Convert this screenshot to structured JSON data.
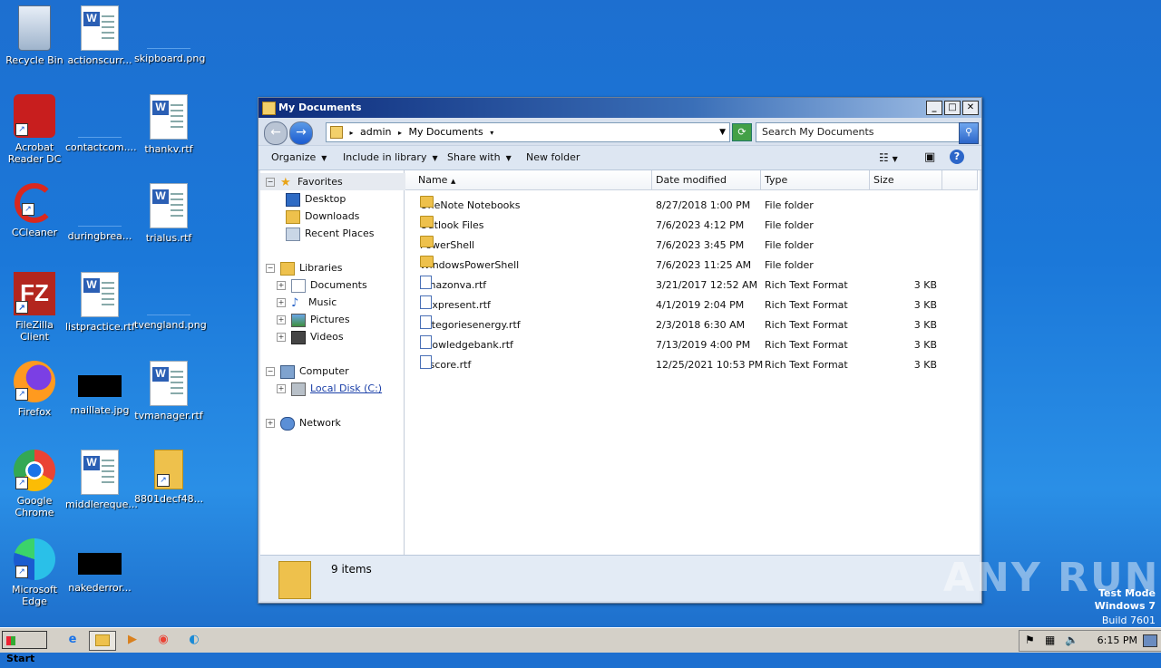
{
  "desktop": {
    "icons": [
      {
        "label": "Recycle Bin"
      },
      {
        "label": "actionscurr..."
      },
      {
        "label": "skipboard.png"
      },
      {
        "label": "Acrobat Reader DC"
      },
      {
        "label": "contactcom...."
      },
      {
        "label": "thankv.rtf"
      },
      {
        "label": "CCleaner"
      },
      {
        "label": "duringbrea..."
      },
      {
        "label": "trialus.rtf"
      },
      {
        "label": "FileZilla Client"
      },
      {
        "label": "listpractice.rtf"
      },
      {
        "label": "tvengland.png"
      },
      {
        "label": "Firefox"
      },
      {
        "label": "maillate.jpg"
      },
      {
        "label": "tvmanager.rtf"
      },
      {
        "label": "Google Chrome"
      },
      {
        "label": "middlereque..."
      },
      {
        "label": "8801decf48..."
      },
      {
        "label": "Microsoft Edge"
      },
      {
        "label": "nakederror..."
      }
    ]
  },
  "window": {
    "title": "My Documents",
    "address": {
      "crumb1": "admin",
      "crumb2": "My Documents"
    },
    "search_placeholder": "Search My Documents",
    "toolbar": {
      "organize": "Organize",
      "include": "Include in library",
      "share": "Share with",
      "new_folder": "New folder"
    },
    "nav": {
      "favorites": "Favorites",
      "desktop": "Desktop",
      "downloads": "Downloads",
      "recent": "Recent Places",
      "libraries": "Libraries",
      "documents": "Documents",
      "music": "Music",
      "pictures": "Pictures",
      "videos": "Videos",
      "computer": "Computer",
      "localdisk": "Local Disk (C:)",
      "network": "Network"
    },
    "columns": {
      "name": "Name",
      "date": "Date modified",
      "type": "Type",
      "size": "Size"
    },
    "files": [
      {
        "name": "OneNote Notebooks",
        "date": "8/27/2018 1:00 PM",
        "type": "File folder",
        "size": "",
        "kind": "folder"
      },
      {
        "name": "Outlook Files",
        "date": "7/6/2023 4:12 PM",
        "type": "File folder",
        "size": "",
        "kind": "folder"
      },
      {
        "name": "PowerShell",
        "date": "7/6/2023 3:45 PM",
        "type": "File folder",
        "size": "",
        "kind": "folder"
      },
      {
        "name": "WindowsPowerShell",
        "date": "7/6/2023 11:25 AM",
        "type": "File folder",
        "size": "",
        "kind": "folder"
      },
      {
        "name": "amazonva.rtf",
        "date": "3/21/2017 12:52 AM",
        "type": "Rich Text Format",
        "size": "3 KB",
        "kind": "rtf"
      },
      {
        "name": "boxpresent.rtf",
        "date": "4/1/2019 2:04 PM",
        "type": "Rich Text Format",
        "size": "3 KB",
        "kind": "rtf"
      },
      {
        "name": "categoriesenergy.rtf",
        "date": "2/3/2018 6:30 AM",
        "type": "Rich Text Format",
        "size": "3 KB",
        "kind": "rtf"
      },
      {
        "name": "knowledgebank.rtf",
        "date": "7/13/2019 4:00 PM",
        "type": "Rich Text Format",
        "size": "3 KB",
        "kind": "rtf"
      },
      {
        "name": "ofscore.rtf",
        "date": "12/25/2021 10:53 PM",
        "type": "Rich Text Format",
        "size": "3 KB",
        "kind": "rtf"
      }
    ],
    "status": "9 items"
  },
  "taskbar": {
    "start": "Start",
    "clock": "6:15 PM"
  },
  "overlay": {
    "watermark": "ANY RUN",
    "testmode1": "Test Mode",
    "testmode2": "Windows 7",
    "testmode3": "Build 7601"
  }
}
